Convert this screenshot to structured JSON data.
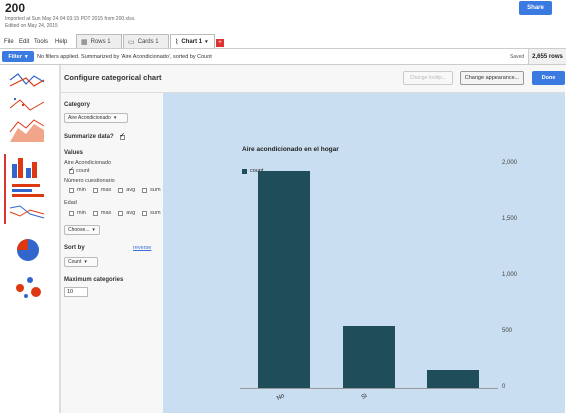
{
  "header": {
    "title": "200",
    "imported": "Imported at Sun May 24 04:03:15 PDT 2015 from 200.xlsx.",
    "edited": "Edited on May 24, 2015",
    "share_label": "Share"
  },
  "menu": [
    "File",
    "Edit",
    "Tools",
    "Help"
  ],
  "tabs": [
    {
      "label": "Rows 1",
      "icon": "table-icon"
    },
    {
      "label": "Cards 1",
      "icon": "cards-icon"
    },
    {
      "label": "Chart 1",
      "icon": "chart-icon",
      "active": true
    }
  ],
  "filterbar": {
    "filter_label": "Filter",
    "status": "No filters applied. Summarized by 'Aire Acondicionado', sorted by Count",
    "saved": "Saved",
    "rows": "2,655 rows"
  },
  "config": {
    "title": "Configure categorical chart",
    "change_tooltip": "Change tooltip...",
    "change_appearance": "Change appearance...",
    "done": "Done",
    "category_label": "Category",
    "category_value": "Aire Acondicionado",
    "summarize_label": "Summarize data?",
    "values_label": "Values",
    "fields": [
      {
        "name": "Aire Acondicionado",
        "options": [
          {
            "label": "count",
            "checked": true
          }
        ]
      },
      {
        "name": "Número cuestionario",
        "options": [
          {
            "label": "min"
          },
          {
            "label": "max"
          },
          {
            "label": "avg"
          },
          {
            "label": "sum"
          }
        ]
      },
      {
        "name": "Edad",
        "options": [
          {
            "label": "min"
          },
          {
            "label": "max"
          },
          {
            "label": "avg"
          },
          {
            "label": "sum"
          }
        ]
      }
    ],
    "choose_label": "Choose...",
    "sortby_label": "Sort by",
    "reverse_label": "reverse",
    "sort_value": "Count",
    "maxcat_label": "Maximum categories",
    "maxcat_value": "10"
  },
  "chart_data": {
    "type": "bar",
    "title": "Aire acondicionado en el hogar",
    "categories": [
      "No",
      "Sí"
    ],
    "series": [
      {
        "name": "count",
        "values": [
          1935,
          555,
          165
        ]
      }
    ],
    "x_tick_labels": [
      "No",
      "Si",
      ""
    ],
    "yticks": [
      "2,000",
      "1,500",
      "1,000",
      "500",
      "0"
    ],
    "ylim": [
      0,
      2000
    ],
    "legend_position": "top-left",
    "color": "#1f4e5a"
  },
  "colors": {
    "accent": "#3b7ae0",
    "chart_bg": "#c9def0",
    "bar": "#1f4e5a"
  }
}
